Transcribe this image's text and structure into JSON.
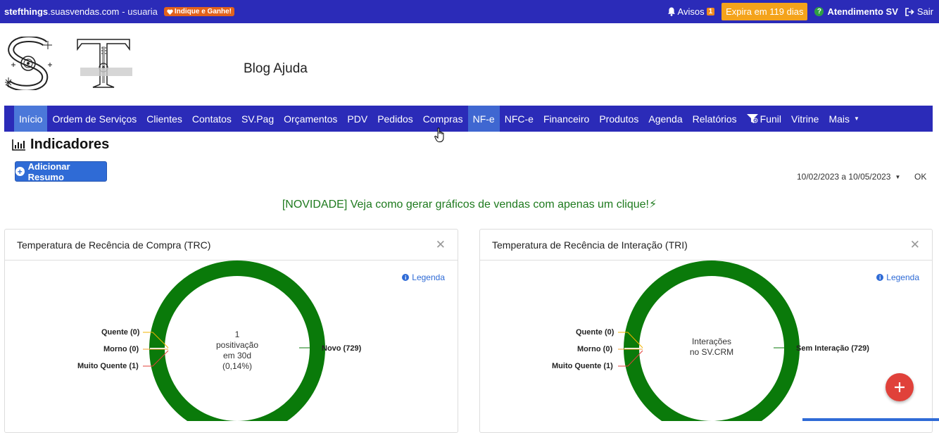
{
  "topbar": {
    "brand_bold": "stefthings",
    "brand_domain": ".suasvendas.com",
    "user": "- usuaria",
    "indique": "Indique e Ganhe!",
    "avisos_label": "Avisos",
    "avisos_count": "1",
    "expira": "Expira em 119 dias",
    "atendimento": "Atendimento SV",
    "sair": "Sair"
  },
  "header": {
    "blog": "Blog Ajuda"
  },
  "nav": {
    "items": [
      {
        "label": "Início"
      },
      {
        "label": "Ordem de Serviços"
      },
      {
        "label": "Clientes"
      },
      {
        "label": "Contatos"
      },
      {
        "label": "SV.Pag"
      },
      {
        "label": "Orçamentos"
      },
      {
        "label": "PDV"
      },
      {
        "label": "Pedidos"
      },
      {
        "label": "Compras"
      },
      {
        "label": "NF-e"
      },
      {
        "label": "NFC-e"
      },
      {
        "label": "Financeiro"
      },
      {
        "label": "Produtos"
      },
      {
        "label": "Agenda"
      },
      {
        "label": "Relatórios"
      },
      {
        "label": "Funil"
      },
      {
        "label": "Vitrine"
      },
      {
        "label": "Mais"
      }
    ]
  },
  "indicadores": {
    "title": "Indicadores",
    "add_button": "Adicionar Resumo",
    "date_range": "10/02/2023 a 10/05/2023",
    "ok": "OK",
    "novidade": "[NOVIDADE] Veja como gerar gráficos de vendas com apenas um clique!⚡"
  },
  "panels": {
    "trc": {
      "title": "Temperatura de Recência de Compra (TRC)",
      "legenda": "Legenda",
      "center_line1": "1",
      "center_line2": "positivação",
      "center_line3": "em 30d",
      "center_line4": "(0,14%)",
      "label_quente": "Quente (0)",
      "label_morno": "Morno (0)",
      "label_muito_quente": "Muito Quente (1)",
      "label_novo": "Novo (729)"
    },
    "tri": {
      "title": "Temperatura de Recência de Interação (TRI)",
      "legenda": "Legenda",
      "center_line1": "Interações",
      "center_line2": "no SV.CRM",
      "label_quente": "Quente (0)",
      "label_morno": "Morno (0)",
      "label_muito_quente": "Muito Quente (1)",
      "label_sem": "Sem Interação (729)"
    }
  },
  "colors": {
    "topbar": "#2b2bb8",
    "donut_green": "#0a7a0a",
    "accent_blue": "#2f6bd6",
    "expira_orange": "#f4a31b",
    "fab_red": "#e0413a"
  }
}
